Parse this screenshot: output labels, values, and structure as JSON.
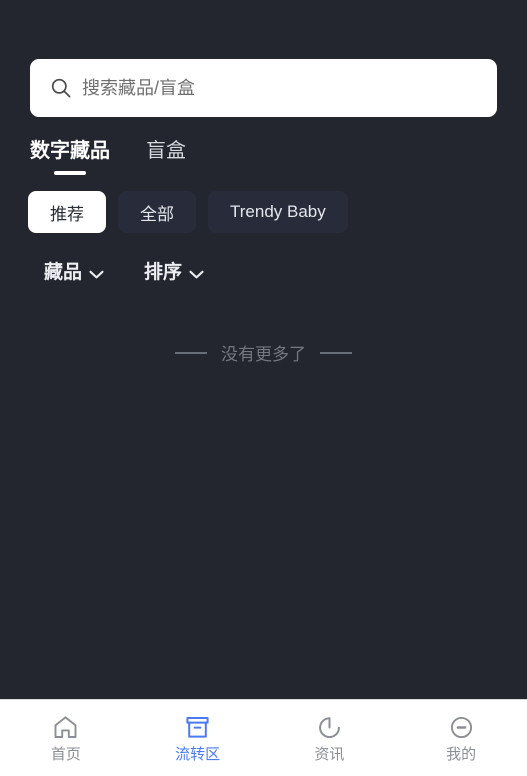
{
  "theme": {
    "background": "#23262f",
    "accent": "#4a7bf0",
    "chip_selected_bg": "#ffffff",
    "chip_unselected_bg": "#272b3a",
    "nav_bg": "#ffffff",
    "muted_text": "#73777f"
  },
  "search": {
    "placeholder": "搜索藏品/盲盒",
    "value": "",
    "icon": "search-icon"
  },
  "tabs": [
    {
      "label": "数字藏品",
      "active": true
    },
    {
      "label": "盲盒",
      "active": false
    }
  ],
  "chips": [
    {
      "label": "推荐",
      "selected": true
    },
    {
      "label": "全部",
      "selected": false
    },
    {
      "label": "Trendy Baby",
      "selected": false
    }
  ],
  "filters": [
    {
      "label": "藏品",
      "icon": "chevron-down-icon"
    },
    {
      "label": "排序",
      "icon": "chevron-down-icon"
    }
  ],
  "empty_state": {
    "text": "没有更多了"
  },
  "bottom_nav": [
    {
      "label": "首页",
      "icon": "home-icon",
      "active": false
    },
    {
      "label": "流转区",
      "icon": "archive-box-icon",
      "active": true
    },
    {
      "label": "资讯",
      "icon": "refresh-circle-icon",
      "active": false
    },
    {
      "label": "我的",
      "icon": "minus-circle-icon",
      "active": false
    }
  ]
}
